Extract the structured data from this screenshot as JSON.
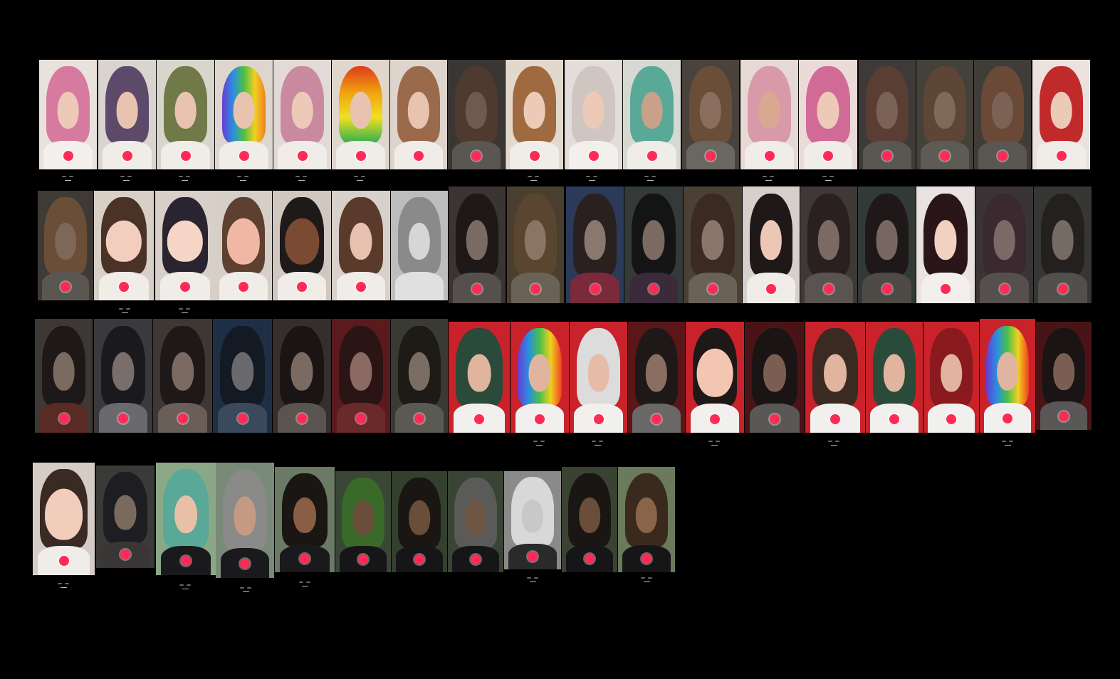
{
  "title": "",
  "rows": [
    {
      "count": 18,
      "style": "female-pink"
    },
    {
      "count": 18,
      "style": "female-avatar"
    },
    {
      "count": 18,
      "style": "mixed"
    },
    {
      "count": 11,
      "style": "male"
    }
  ],
  "palette": {
    "skin_light": "#e8c3b0",
    "skin_mid": "#c99a7e",
    "skin_dark": "#7a4a33",
    "hair_pink": "#d77aa0",
    "hair_brown": "#6b4a36",
    "hair_black": "#1e1a1a",
    "hair_teal": "#5aa898",
    "hair_red": "#c02a2a",
    "hair_rainbow": "#e58a2a",
    "bg_red": "#c9222a",
    "bg_white": "#e9e5e2",
    "bg_grey": "#4a4a4a",
    "record": "#ff2a55",
    "page_bg": "#000000"
  }
}
